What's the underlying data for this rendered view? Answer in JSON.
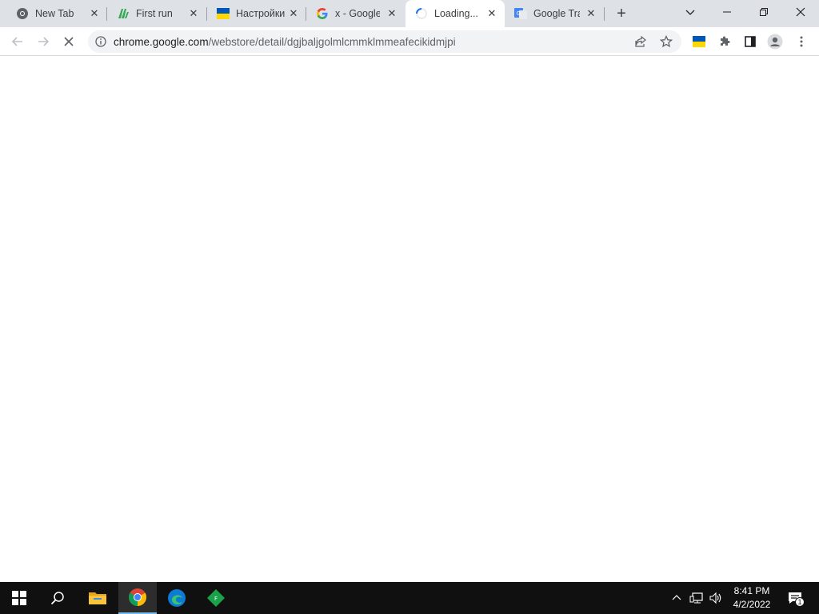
{
  "tabs": [
    {
      "title": "New Tab",
      "icon": "chrome-icon"
    },
    {
      "title": "First run",
      "icon": "firstrun-icon"
    },
    {
      "title": "Настройки",
      "icon": "ukraine-flag-icon"
    },
    {
      "title": "x - Google",
      "icon": "google-icon"
    },
    {
      "title": "Loading...",
      "icon": "loading-spinner-icon",
      "active": true
    },
    {
      "title": "Google Tra",
      "icon": "google-translate-icon"
    }
  ],
  "address": {
    "host": "chrome.google.com",
    "path": "/webstore/detail/dgjbaljgolmlcmmklmmeafecikidmjpi"
  },
  "taskbar": {
    "time": "8:41 PM",
    "date": "4/2/2022",
    "notification_count": "1"
  }
}
